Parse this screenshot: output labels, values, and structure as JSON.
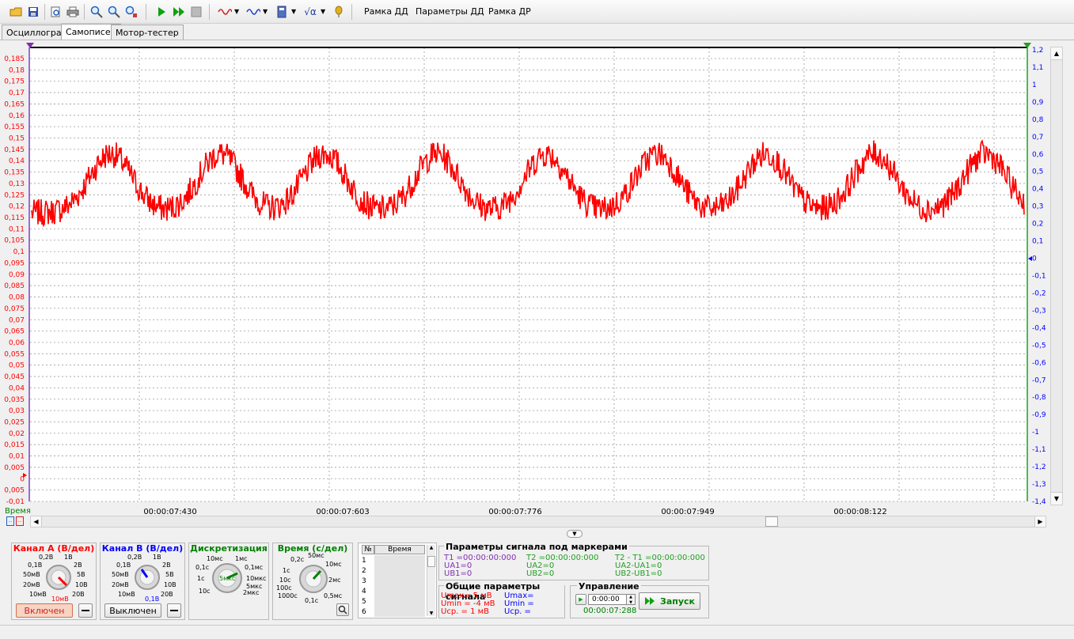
{
  "toolbar": {
    "icons": [
      "open-folder-icon",
      "save-icon",
      "print-preview-icon",
      "print-icon",
      "zoom-in-icon",
      "zoom-out-icon",
      "zoom-fit-icon",
      "play-icon",
      "play-fast-icon",
      "stop-icon",
      "signal-a-icon",
      "signal-b-icon",
      "calculator-icon",
      "sqrt-icon",
      "pin-icon"
    ],
    "frame_dd": "Рамка ДД",
    "params_dd": "Параметры ДД",
    "frame_dr": "Рамка ДР"
  },
  "tabs": [
    {
      "label": "Осциллограф",
      "active": false
    },
    {
      "label": "Самописец",
      "active": true
    },
    {
      "label": "Мотор-тестер",
      "active": false
    }
  ],
  "plot": {
    "left_axis_labels": [
      "0,185",
      "0,18",
      "0,175",
      "0,17",
      "0,165",
      "0,16",
      "0,155",
      "0,15",
      "0,145",
      "0,14",
      "0,135",
      "0,13",
      "0,125",
      "0,12",
      "0,115",
      "0,11",
      "0,105",
      "0,1",
      "0,095",
      "0,09",
      "0,085",
      "0,08",
      "0,075",
      "0,07",
      "0,065",
      "0,06",
      "0,055",
      "0,05",
      "0,045",
      "0,04",
      "0,035",
      "0,03",
      "0,025",
      "0,02",
      "0,015",
      "0,01",
      "0,005",
      "0",
      "0,005",
      "-0,01"
    ],
    "right_axis_labels": [
      "1,2",
      "1,1",
      "1",
      "0,9",
      "0,8",
      "0,7",
      "0,6",
      "0,5",
      "0,4",
      "0,3",
      "0,2",
      "0,1",
      "0",
      "-0,1",
      "-0,2",
      "-0,3",
      "-0,4",
      "-0,5",
      "-0,6",
      "-0,7",
      "-0,8",
      "-0,9",
      "-1",
      "-1,1",
      "-1,2",
      "-1,3",
      "-1,4"
    ],
    "time_labels": [
      "00:00:07:430",
      "00:00:07:603",
      "00:00:07:776",
      "00:00:07:949",
      "00:00:08:122"
    ],
    "time_axis_title": "Время",
    "colors": {
      "channel_a": "#ff0000",
      "channel_b": "#0000ff",
      "grid": "#9a9a9a",
      "time_label": "#008000"
    }
  },
  "channel_a": {
    "title": "Канал А (В/дел)",
    "labels": [
      "0,2В",
      "1В",
      "0,1В",
      "2В",
      "50мВ",
      "5В",
      "20мВ",
      "10В",
      "10мВ",
      "20В"
    ],
    "current": "10мВ",
    "toggle": "Включен"
  },
  "channel_b": {
    "title": "Канал В (В/дел)",
    "labels": [
      "0,2В",
      "1В",
      "0,1В",
      "2В",
      "50мВ",
      "5В",
      "20мВ",
      "10В",
      "10мВ",
      "20В"
    ],
    "current": "0,1В",
    "toggle": "Выключен"
  },
  "sampling": {
    "title": "Дискретизация",
    "labels": [
      "10мс",
      "1мс",
      "0,1с",
      "0,1мс",
      "1с",
      "10мкс",
      "10с",
      "5мкс",
      "2мкс"
    ],
    "current": "5мкс"
  },
  "timebase": {
    "title": "Время (с/дел)",
    "labels": [
      "50мс",
      "0,2с",
      "10мс",
      "1с",
      "10с",
      "2мс",
      "100с",
      "1000с",
      "0,1с",
      "0,5мс"
    ]
  },
  "markers_table": {
    "col_num": "№",
    "col_time": "Время",
    "rows": [
      "1",
      "2",
      "3",
      "4",
      "5",
      "6"
    ]
  },
  "marker_params": {
    "title": "Параметры сигнала под маркерами",
    "t1": "T1 =00:00:00:000",
    "ua1": "UA1=0",
    "ub1": "UB1=0",
    "t2": "T2 =00:00:00:000",
    "ua2": "UA2=0",
    "ub2": "UB2=0",
    "dt": "T2 - T1 =00:00:00:000",
    "dua": "UA2-UA1=0",
    "dub": "UB2-UB1=0"
  },
  "general_params": {
    "title": "Общие параметры сигнала",
    "a_umax": "Umax=  5 мВ",
    "a_umin": "Umin = -4 мВ",
    "a_ucp": "Uср. =  1 мВ",
    "b_umax": "Umax=",
    "b_umin": "Umin =",
    "b_ucp": "Uср. ="
  },
  "control": {
    "title": "Управление",
    "time_value": "0:00:00",
    "elapsed": "00:00:07:288",
    "start_label": "Запуск"
  }
}
